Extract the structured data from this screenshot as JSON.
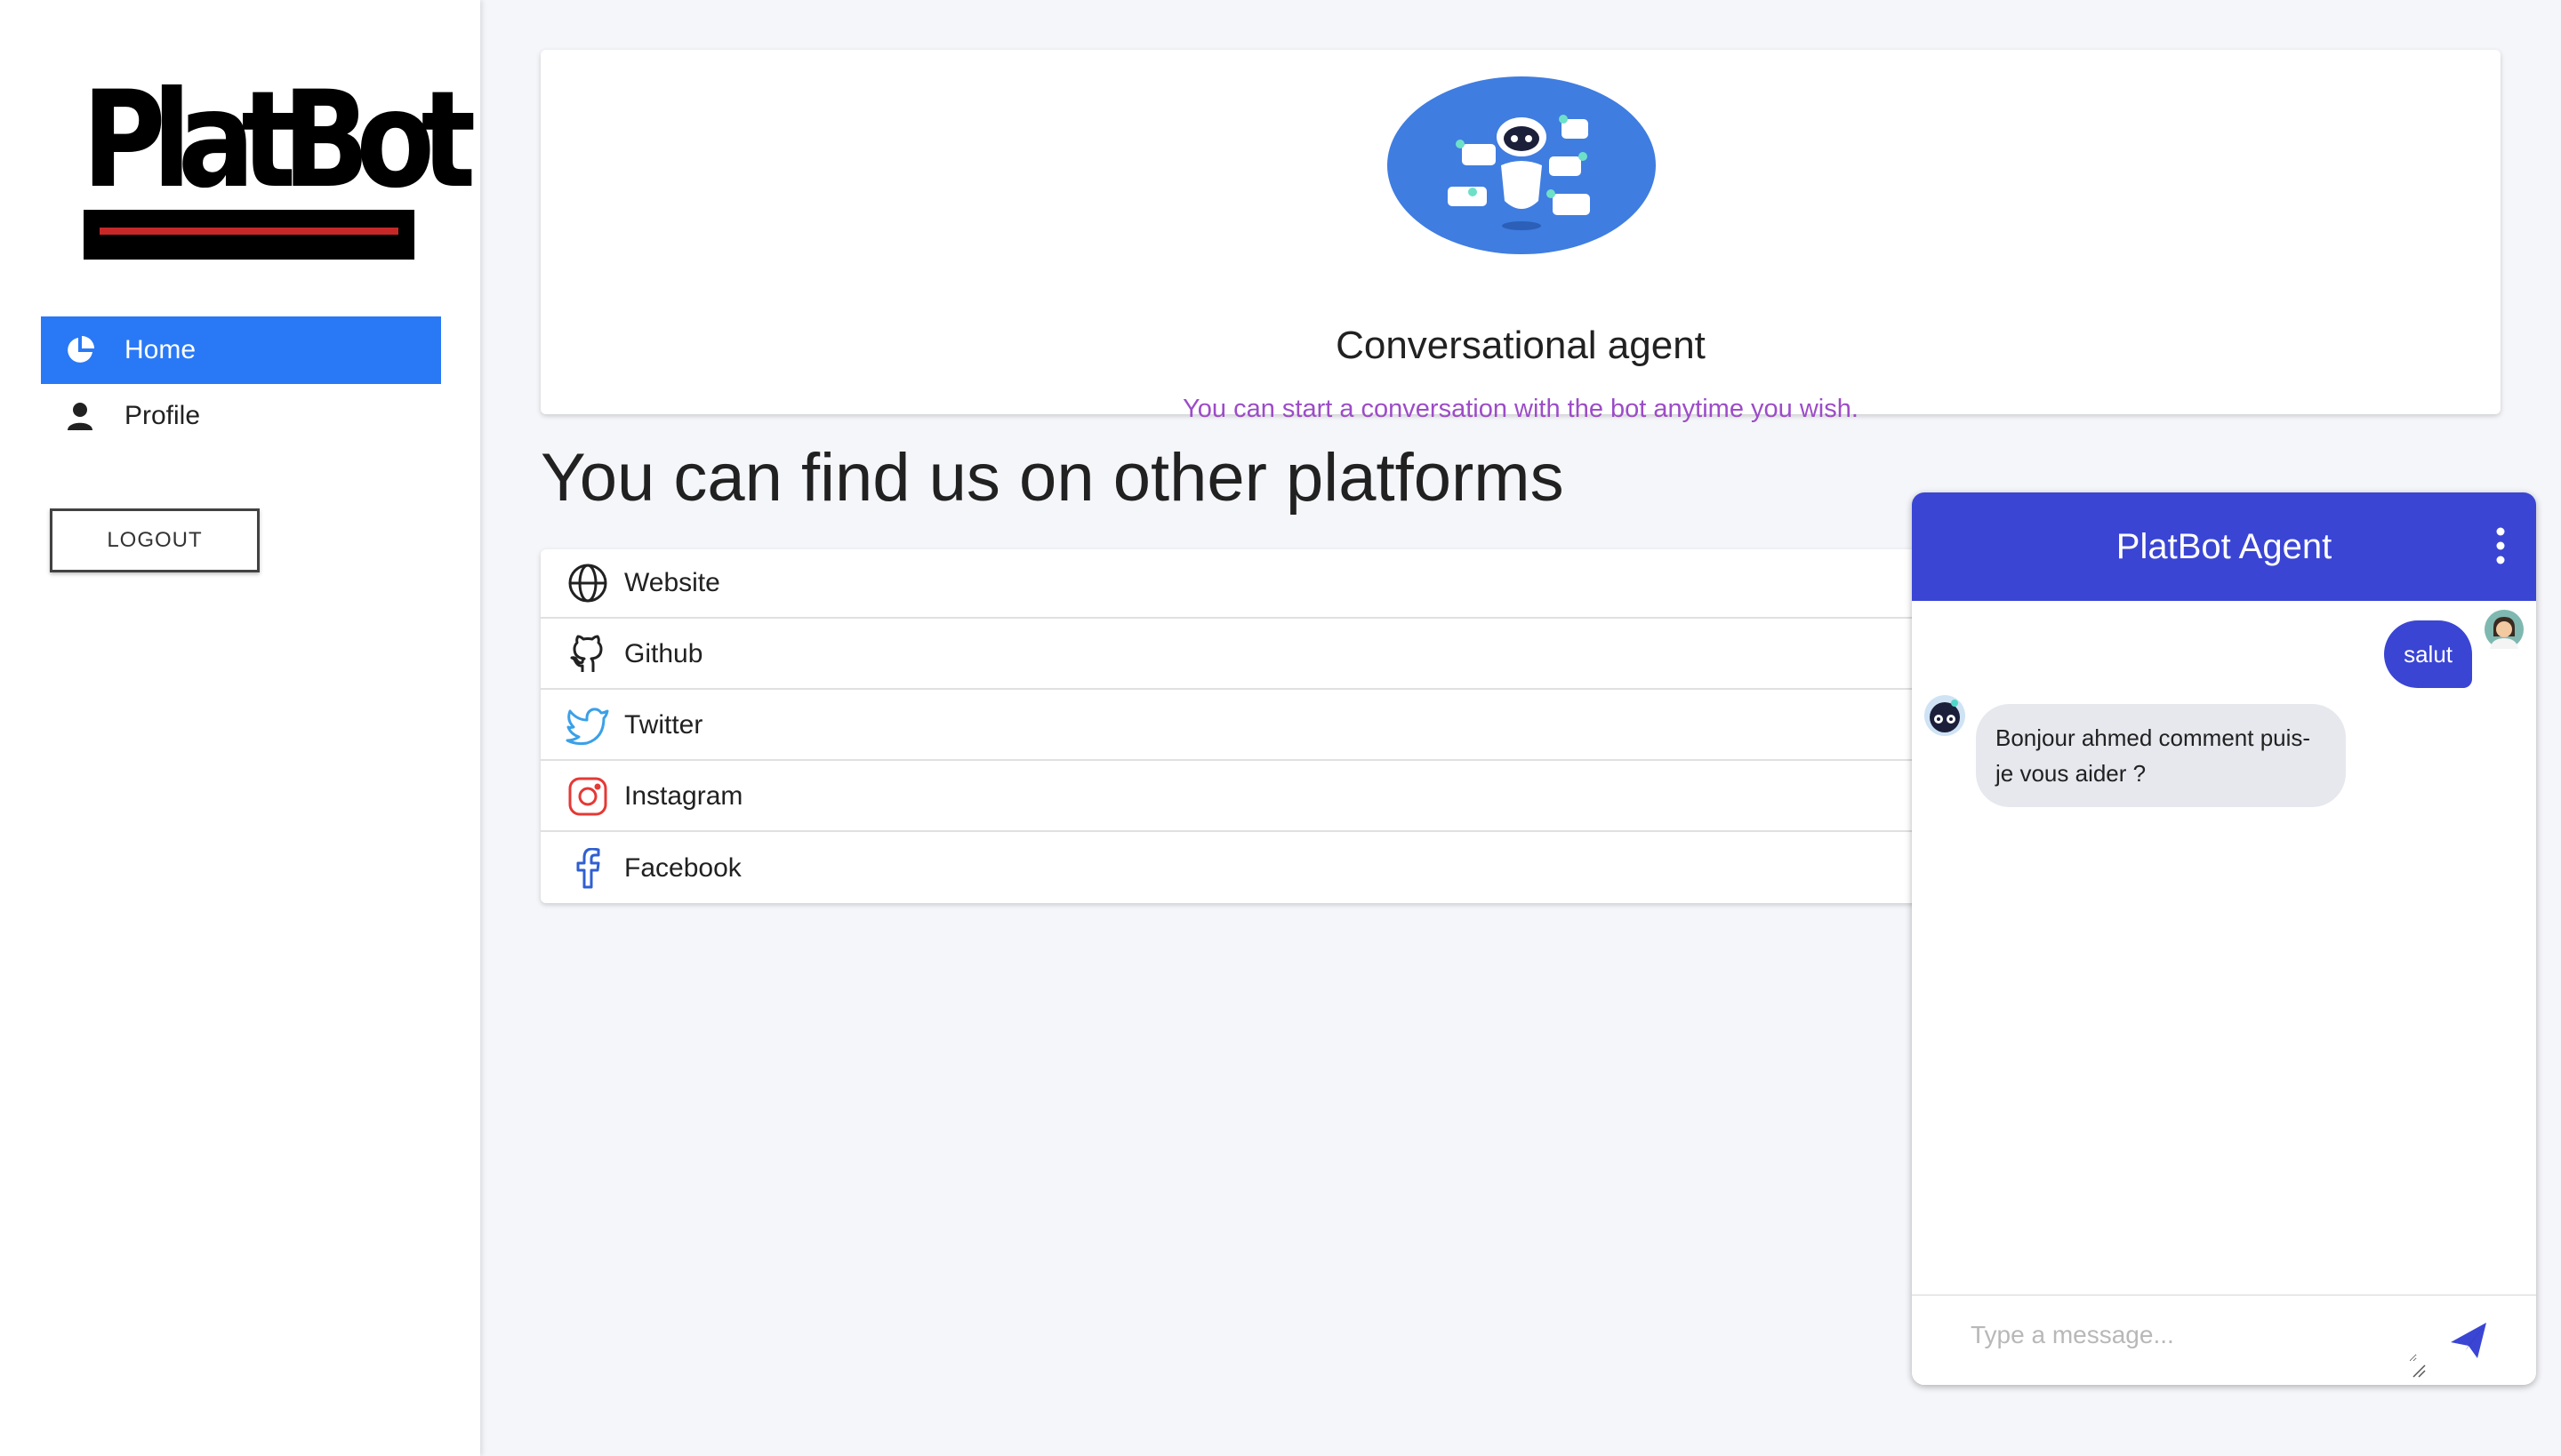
{
  "sidebar": {
    "logo_text": "PlatBot",
    "nav": [
      {
        "label": "Home",
        "icon": "pie-chart-icon",
        "active": true
      },
      {
        "label": "Profile",
        "icon": "person-icon",
        "active": false
      }
    ],
    "logout_label": "LOGOUT"
  },
  "agent_card": {
    "title": "Conversational agent",
    "subtitle": "You can start a conversation with the bot anytime you wish."
  },
  "platforms": {
    "heading": "You can find us on other platforms",
    "items": [
      {
        "label": "Website",
        "icon": "globe-icon"
      },
      {
        "label": "Github",
        "icon": "github-icon"
      },
      {
        "label": "Twitter",
        "icon": "twitter-icon"
      },
      {
        "label": "Instagram",
        "icon": "instagram-icon"
      },
      {
        "label": "Facebook",
        "icon": "facebook-icon"
      }
    ]
  },
  "chat": {
    "title": "PlatBot Agent",
    "messages": [
      {
        "from": "user",
        "text": "salut"
      },
      {
        "from": "bot",
        "text": "Bonjour ahmed comment puis-je vous aider ?"
      }
    ],
    "input_placeholder": "Type a message..."
  },
  "colors": {
    "accent_blue": "#2979f6",
    "chat_header": "#3a45d4",
    "subtitle_purple": "#9c4cc8",
    "bot_bubble": "#e6e8ee",
    "background": "#f5f6fa"
  }
}
